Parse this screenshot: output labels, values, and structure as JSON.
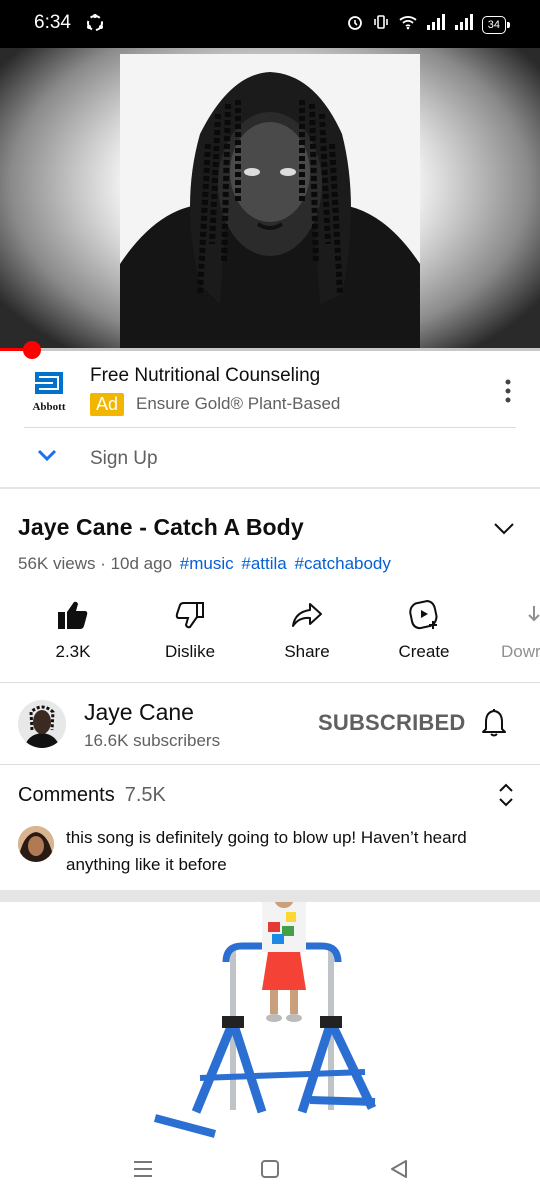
{
  "status_bar": {
    "time": "6:34",
    "battery": "34"
  },
  "player": {
    "progress_fraction": 0.06
  },
  "ad": {
    "brand_logo_text": "Abbott",
    "title": "Free Nutritional Counseling",
    "badge": "Ad",
    "subtitle": "Ensure Gold® Plant-Based",
    "cta": "Sign Up"
  },
  "video": {
    "title": "Jaye Cane - Catch A Body",
    "stats": "56K views · 10d ago",
    "tags": [
      "#music",
      "#attila",
      "#catchabody"
    ]
  },
  "actions": [
    {
      "name": "like-button",
      "label": "2.3K",
      "icon": "thumbs-up-icon"
    },
    {
      "name": "dislike-button",
      "label": "Dislike",
      "icon": "thumbs-down-icon"
    },
    {
      "name": "share-button",
      "label": "Share",
      "icon": "share-icon"
    },
    {
      "name": "create-button",
      "label": "Create",
      "icon": "create-icon"
    },
    {
      "name": "download-button",
      "label": "Dowr",
      "icon": "download-icon"
    }
  ],
  "channel": {
    "name": "Jaye Cane",
    "subscribers": "16.6K subscribers",
    "subscribe_state": "SUBSCRIBED"
  },
  "comments": {
    "label": "Comments",
    "count": "7.5K",
    "top_comment": "this song is definitely going to blow up! Haven’t heard anything like it before"
  },
  "colors": {
    "accent_red": "#ff0000",
    "link_blue": "#065fd4",
    "ad_badge": "#f2b600",
    "abbott_blue": "#0072ce"
  }
}
